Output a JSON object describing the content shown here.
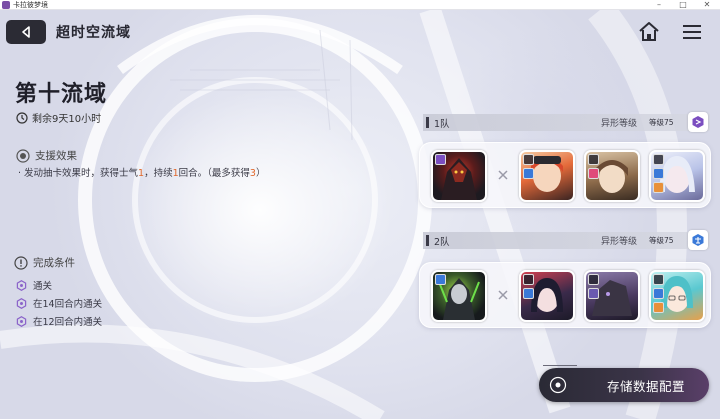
{
  "window": {
    "title": "卡拉彼梦境",
    "controls": {
      "minimize": "–",
      "maximize": "□",
      "close": "✕"
    }
  },
  "header": {
    "page_title": "超时空流域",
    "back_icon": "back-arrow-icon",
    "home_icon": "home-icon",
    "menu_icon": "menu-icon"
  },
  "region": {
    "name": "第十流域",
    "time_remaining": "剩余9天10小时"
  },
  "support": {
    "title": "支援效果",
    "desc_prefix": "· 发动抽卡效果时，获得士气",
    "desc_v1": "1",
    "desc_mid": "，持续",
    "desc_v2": "1",
    "desc_suffix": "回合。（最多获得",
    "desc_v3": "3",
    "desc_end": "）"
  },
  "conditions": {
    "title": "完成条件",
    "items": [
      {
        "label": "通关"
      },
      {
        "label": "在14回合内通关"
      },
      {
        "label": "在12回合内通关"
      }
    ]
  },
  "teams": [
    {
      "name": "1队",
      "rank_label": "异形等级",
      "level_label": "等级75",
      "badge_icon": "crystal-type-icon",
      "portraits": [
        "dark-armored-boss",
        "red-haired-girl",
        "brown-haired-girl",
        "white-haired-girl"
      ]
    },
    {
      "name": "2队",
      "rank_label": "异形等级",
      "level_label": "等级75",
      "badge_icon": "balance-type-icon",
      "portraits": [
        "silver-mech-boss",
        "dark-haired-girl",
        "stone-beast",
        "teal-haired-girl"
      ]
    }
  ],
  "save_button": {
    "label": "存储数据配置"
  },
  "colors": {
    "accent": "#e0672a",
    "dark": "#2b2b34",
    "purple": "#7b4ec0"
  }
}
